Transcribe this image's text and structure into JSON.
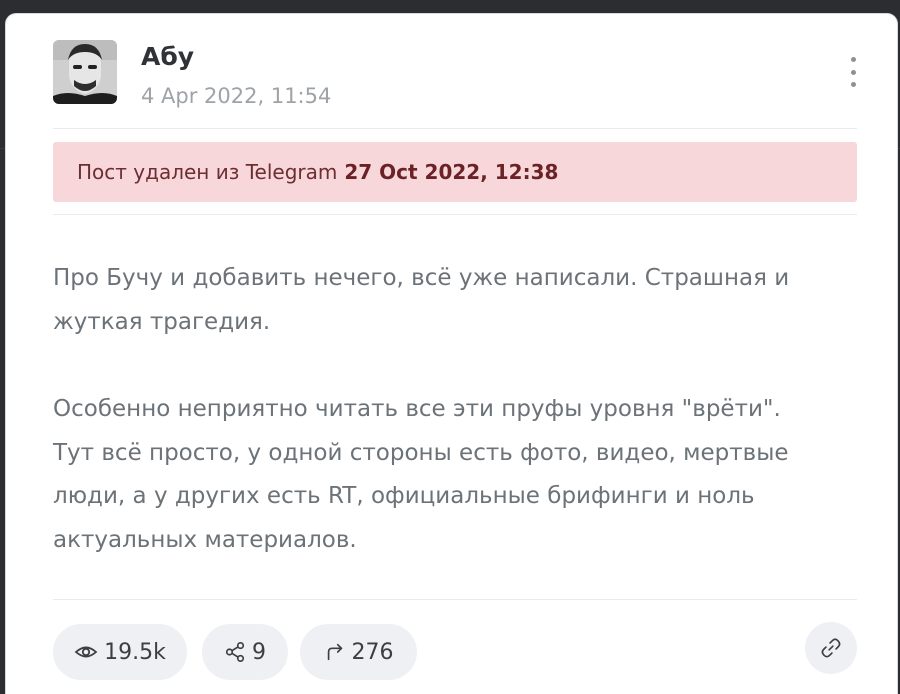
{
  "post": {
    "author": "Абу",
    "date": "4 Apr 2022, 11:54",
    "deleted_notice": {
      "prefix": "Пост удален из Telegram",
      "date": "27 Oct 2022, 12:38"
    },
    "paragraphs": [
      "Про Бучу и добавить нечего, всё уже написали. Страшная и\nжуткая трагедия.",
      "Особенно неприятно читать все эти пруфы уровня \"врёти\".\nТут всё просто, у одной стороны есть фото, видео, мертвые\nлюди, а у других есть RT, официальные брифинги и ноль\nактуальных материалов."
    ]
  },
  "stats": {
    "views": "19.5k",
    "shares": "9",
    "forwards": "276"
  },
  "icons": {
    "avatar": "avatar-photo",
    "more": "more-vertical-icon",
    "views": "eye-icon",
    "shares": "share-nodes-icon",
    "forwards": "forward-arrow-icon",
    "link": "link-icon"
  },
  "colors": {
    "banner_bg": "#f8d7da",
    "banner_text": "#6b2227",
    "text": "#6c7378",
    "pill_bg": "#eef0f3"
  }
}
